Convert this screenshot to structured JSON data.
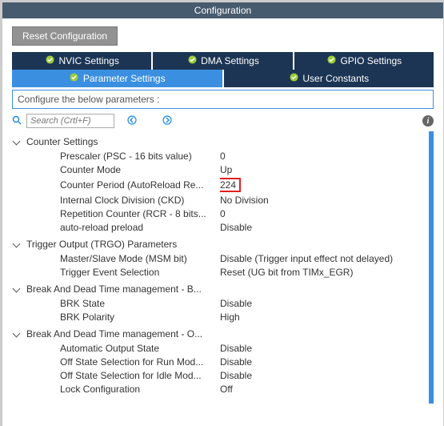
{
  "window": {
    "title": "Configuration"
  },
  "buttons": {
    "reset": "Reset Configuration"
  },
  "tabs": {
    "row1": [
      {
        "label": "NVIC Settings"
      },
      {
        "label": "DMA Settings"
      },
      {
        "label": "GPIO Settings"
      }
    ],
    "row2": [
      {
        "label": "Parameter Settings"
      },
      {
        "label": "User Constants"
      }
    ]
  },
  "description": "Configure the below parameters :",
  "search": {
    "placeholder": "Search (Crtl+F)"
  },
  "groups": [
    {
      "title": "Counter Settings",
      "rows": [
        {
          "label": "Prescaler (PSC - 16 bits value)",
          "value": "0"
        },
        {
          "label": "Counter Mode",
          "value": "Up"
        },
        {
          "label": "Counter Period (AutoReload Re...",
          "value": "224",
          "highlight": true
        },
        {
          "label": "Internal Clock Division (CKD)",
          "value": "No Division"
        },
        {
          "label": "Repetition Counter (RCR - 8 bits...",
          "value": "0"
        },
        {
          "label": "auto-reload preload",
          "value": "Disable"
        }
      ]
    },
    {
      "title": "Trigger Output (TRGO) Parameters",
      "rows": [
        {
          "label": "Master/Slave Mode (MSM bit)",
          "value": "Disable (Trigger input effect not delayed)"
        },
        {
          "label": "Trigger Event Selection",
          "value": "Reset (UG bit from TIMx_EGR)"
        }
      ]
    },
    {
      "title": "Break And Dead Time management - B...",
      "rows": [
        {
          "label": "BRK State",
          "value": "Disable"
        },
        {
          "label": "BRK Polarity",
          "value": "High"
        }
      ]
    },
    {
      "title": "Break And Dead Time management - O...",
      "rows": [
        {
          "label": "Automatic Output State",
          "value": "Disable"
        },
        {
          "label": "Off State Selection for Run Mod...",
          "value": "Disable"
        },
        {
          "label": "Off State Selection for Idle Mod...",
          "value": "Disable"
        },
        {
          "label": "Lock Configuration",
          "value": "Off"
        }
      ]
    }
  ]
}
